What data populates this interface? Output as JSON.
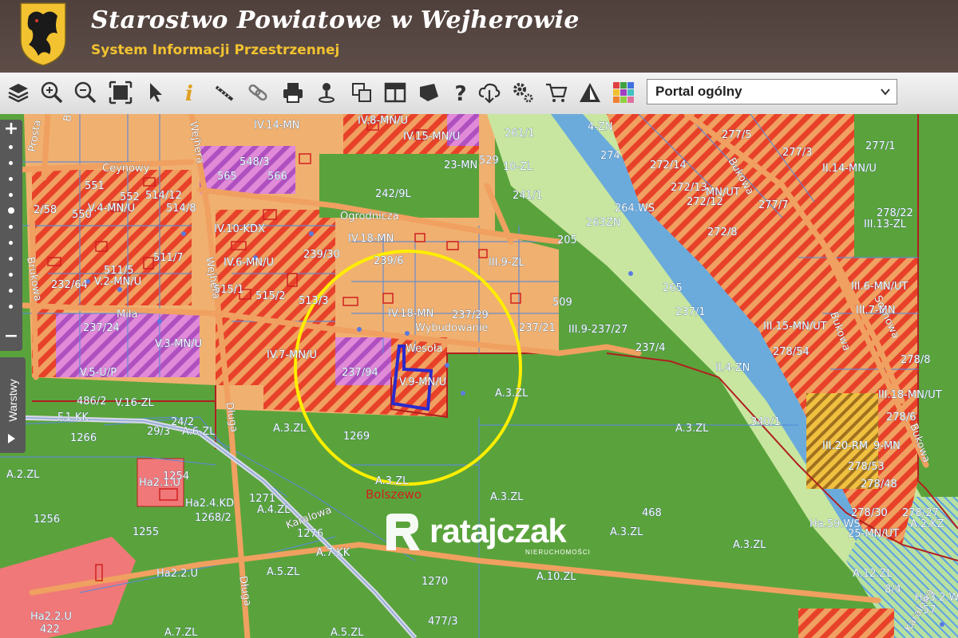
{
  "header": {
    "title": "Starostwo Powiatowe w Wejherowie",
    "subtitle": "System Informacji Przestrzennej"
  },
  "toolbar": {
    "tools": [
      "layers-icon",
      "zoom-in-icon",
      "zoom-out-icon",
      "zoom-extent-icon",
      "select-arrow-icon",
      "info-icon",
      "measure-icon",
      "link-icon",
      "print-icon",
      "locate-icon",
      "compare-icon",
      "layout-icon",
      "shape-icon",
      "help-icon",
      "download-icon",
      "settings-icon",
      "cart-icon",
      "warning-icon",
      "color-grid-icon"
    ],
    "portal_select": "Portal ogólny"
  },
  "sidebar": {
    "zoom_in": "+",
    "zoom_out": "−",
    "layers_label": "Warstwy"
  },
  "map": {
    "labels": {
      "boczna": "Boczna",
      "prosta": "Prosta",
      "ceynowy": "Ceynowy",
      "wejhera": "Wejhera",
      "brukowa": "Brukowa",
      "mila": "Mila",
      "dluga": "Długa",
      "ogrodnicza": "Ogrodnicza",
      "wesola": "Wesoła",
      "wybudowanie": "Wybudowanie",
      "bukowa": "Bukowa",
      "sosnowa": "Sosnowa",
      "karalowa": "Karalowa",
      "bolszewo": "Bolszewo",
      "l_iv14mn": "IV.14-MN",
      "l_iv8mnu": "IV.8-MN/U",
      "l_iv15mnu": "IV.15-MN/U",
      "l_548_3": "548/3",
      "l_565": "565",
      "l_566": "566",
      "l_551": "551",
      "l_552": "552",
      "l_514_12": "514/12",
      "l_2_58": "2/58",
      "l_550": "550",
      "l_v4mnu": "V.4-MN/U",
      "l_514_8": "514/8",
      "l_iv10kdx": "IV.10-KDX",
      "l_iv6mnu": "IV.6-MN/U",
      "l_511_7": "511/7",
      "l_511_5": "511/5",
      "l_232_64": "232/64",
      "l_v2mnu": "V.2-MN/U",
      "l_515_1": "515/1",
      "l_515_2": "515/2",
      "l_239_30": "239/30",
      "l_iv18mn": "IV.18-MN",
      "l_239_6": "239/6",
      "l_iii9zl": "III.9-ZL",
      "l_513_3": "513/3",
      "l_iv18mn_b": "IV.18-MN",
      "l_237_29": "237/29",
      "l_509": "509",
      "l_237_21": "237/21",
      "l_iii9_237_27": "III.9-237/27",
      "l_237_4": "237/4",
      "l_237_24": "237/24",
      "l_v3mnu": "V.3-MN/U",
      "l_iv7mnu": "IV.7-MN/U",
      "l_237_94": "237/94",
      "l_v9mnu": "V.9-MN/U",
      "l_v5up": "V.5-U/P",
      "l_486_2": "486/2",
      "l_v16zl": "V.16-ZL",
      "l_a3zl_1": "A.3.ZL",
      "l_a3zl_2": "A.3.ZL",
      "l_a3zl_3": "A.3.ZL",
      "l_a3zl_4": "A.3.ZL",
      "l_a3zl_5": "A.3.ZL",
      "l_a3zl_6": "A.3.ZL",
      "l_a3zl_7": "A.3.ZL",
      "l_1269": "1269",
      "l_1266": "1266",
      "l_24_2": "24/2",
      "l_29_3": "29/3",
      "l_a6zl": "A.6.ZL",
      "l_f1kk": "F.1.KK",
      "l_a2zl": "A.2.ZL",
      "l_ha21u": "Ha2.1.U",
      "l_1254": "1254",
      "l_ha24kd": "Ha2.4.KD",
      "l_1271": "1271",
      "l_a4zl": "A.4.ZL",
      "l_1256": "1256",
      "l_1268_2": "1268/2",
      "l_1255": "1255",
      "l_a7kk": "A.7.KK",
      "l_1276": "1276",
      "l_ha22u": "Ha2.2.U",
      "l_ha22u_b": "Ha2.2.U",
      "l_422": "422",
      "l_a5zl": "A.5.ZL",
      "l_1270": "1270",
      "l_a10zl": "A.10.ZL",
      "l_477_3": "477/3",
      "l_a7zl": "A.7.ZL",
      "l_a5zl_b": "A.5.ZL",
      "l_468": "468",
      "l_261_1": "261/1",
      "l_4zn": "4-ZN",
      "l_274": "274",
      "l_23mn": "23-MN",
      "l_529": "529",
      "l_10zl": "10-ZL",
      "l_242_9": "242/9L",
      "l_241_1": "241/1",
      "l_263zn": "263ZN",
      "l_264ws": "264.WS",
      "l_205": "205",
      "l_265": "265",
      "l_237_1": "237/1",
      "l_ii4zn": "II.4-ZN",
      "l_340_1": "340/1",
      "l_277_5": "277/5",
      "l_277_3": "277/3",
      "l_277_1": "277/1",
      "l_272_14": "272/14",
      "l_272_13": "272/13",
      "l_272_12": "272/12",
      "l_mnut": "MN/UT",
      "l_ii14mnu": "II.14-MN/U",
      "l_277_7": "277/7",
      "l_278_22": "278/22",
      "l_iii13zl": "III.13-ZL",
      "l_272_8": "272/8",
      "l_iii15mnut": "III.15-MN/UT",
      "l_iii6mnut": "III.6-MN/UT",
      "l_iii7mn": "III.7-MN",
      "l_278_54": "278/54",
      "l_278_8": "278/8",
      "l_iii18mnut": "III.18-MN/UT",
      "l_278_6": "278/6",
      "l_iii20rm": "III.20-RM",
      "l_9mn": "9-MN",
      "l_278_53": "278/53",
      "l_278_48": "278/48",
      "l_278_30": "278/30",
      "l_278_27": "278/27",
      "l_ha59ws": "Ha.59.WS",
      "l_25mnut": "25-MN/UT",
      "l_a12zl": "A.12.ZL",
      "l_ha32": "Ha3.2.W",
      "l_57": "57",
      "l_8_4": "8/4",
      "l_a2kz": "A.2.KZ",
      "l_reda": "Reda"
    }
  },
  "logo": {
    "text": "ratajczak",
    "sub": "NIERUCHOMOŚCI"
  },
  "colors": {
    "header_bg": "#5a4a44",
    "title": "#ffffff",
    "subtitle": "#f2c230",
    "residential": "#f0a75c",
    "hatch_red": "#e8412a",
    "forest": "#5aa33c",
    "meadow": "#c8e6a0",
    "water": "#5aa0e6",
    "pink": "#d97ad2",
    "highlight_circle": "#ffee00",
    "parcel_outline": "#2a2acc"
  }
}
